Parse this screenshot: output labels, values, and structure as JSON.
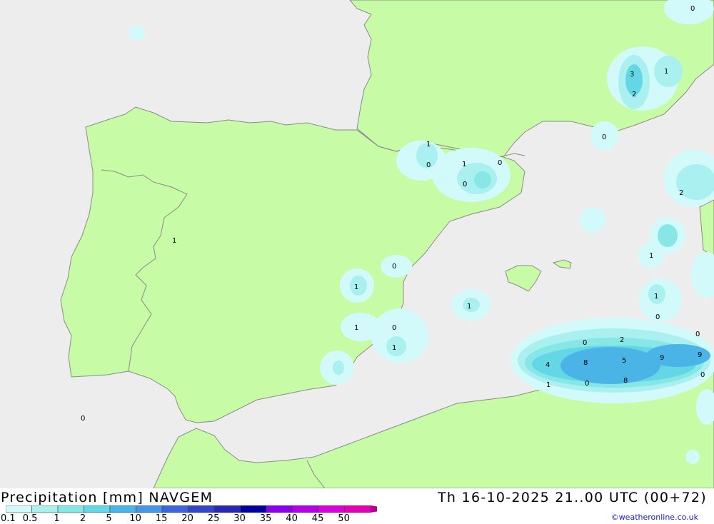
{
  "map": {
    "land_color": "#c8fba6",
    "sea_color": "#ededed",
    "border_color": "#8a8a8a",
    "precip_labels": [
      "0",
      "3",
      "1",
      "2",
      "0",
      "1",
      "0",
      "1",
      "0",
      "0",
      "1",
      "2",
      "1",
      "0",
      "1",
      "1",
      "0",
      "1",
      "1",
      "1",
      "0",
      "2",
      "0",
      "4",
      "8",
      "5",
      "9",
      "9",
      "1",
      "0",
      "8",
      "0",
      "0",
      "0"
    ]
  },
  "footer": {
    "title": "Precipitation [mm] NAVGEM",
    "datetime": "Th 16-10-2025 21..00 UTC (00+72)",
    "credit": "©weatheronline.co.uk"
  },
  "legend": {
    "ticks": [
      "0.1",
      "0.5",
      "1",
      "2",
      "5",
      "10",
      "15",
      "20",
      "25",
      "30",
      "35",
      "40",
      "45",
      "50"
    ],
    "colors": [
      "#d2fafa",
      "#aaf0f0",
      "#87e6e6",
      "#64d7e6",
      "#4bb4e6",
      "#4696e6",
      "#3c64dc",
      "#3246c8",
      "#2828b4",
      "#0000a0",
      "#8c00f0",
      "#b400e6",
      "#dc00dc",
      "#e600b4"
    ],
    "arrow_color": "#b4009b"
  }
}
